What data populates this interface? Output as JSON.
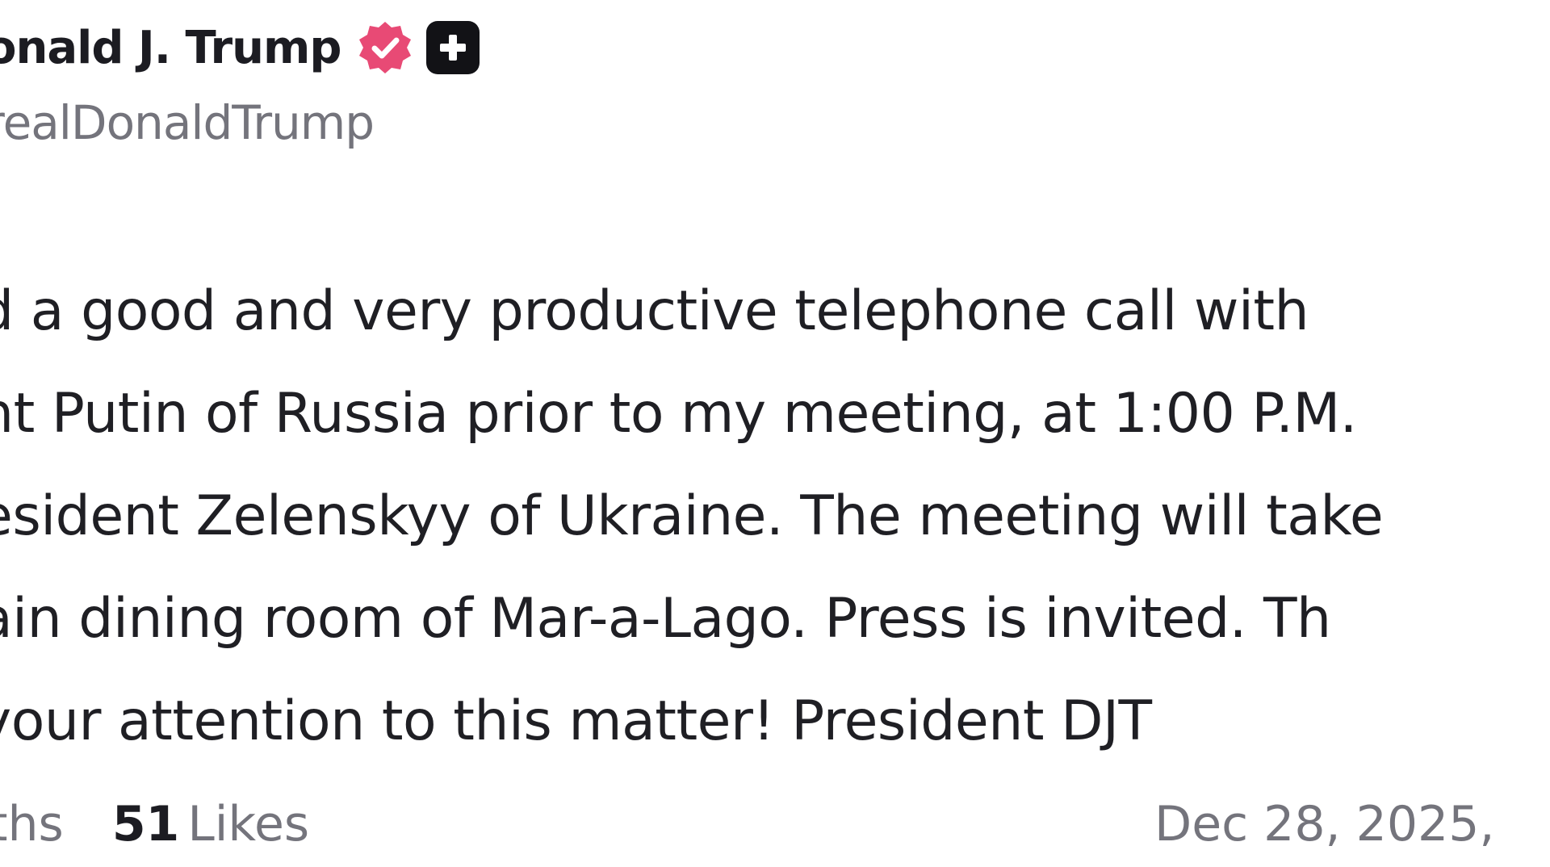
{
  "author": {
    "display_name": "onald J. Trump",
    "handle": "realDonaldTrump",
    "verified_icon": "verified-check-icon",
    "plus_icon": "plus-square-icon",
    "verified_color": "#e84a75"
  },
  "post": {
    "lines": [
      "d a good and very productive telephone call with",
      "nt Putin of Russia prior to my meeting, at 1:00 P.M.",
      "esident Zelenskyy of Ukraine. The meeting will take",
      "ain dining room of Mar-a-Lago. Press is invited. Th",
      "your attention to this matter! President DJT"
    ]
  },
  "stats": {
    "partial_label": "ths",
    "likes_count": "51",
    "likes_label": "Likes",
    "timestamp": "Dec 28, 2025,"
  }
}
